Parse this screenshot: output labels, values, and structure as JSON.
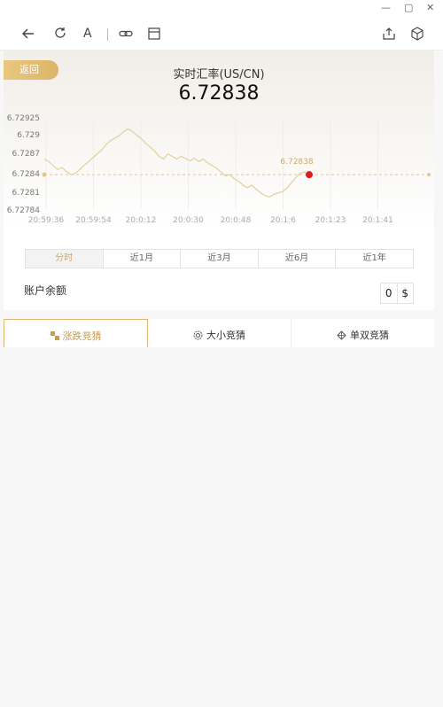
{
  "window": {
    "minimize_glyph": "—",
    "maximize_glyph": "▢",
    "close_glyph": "✕"
  },
  "toolbar": {
    "font_label": "A",
    "icons": [
      "back-arrow-icon",
      "refresh-icon",
      "font-icon",
      "link-icon",
      "window-icon",
      "share-icon",
      "cube-icon"
    ]
  },
  "header": {
    "back_label": "返回",
    "title": "实时汇率(US/CN)",
    "rate": "6.72838"
  },
  "chart_data": {
    "type": "line",
    "title": "",
    "y_ticks": [
      "6.72925",
      "6.729",
      "6.7287",
      "6.7284",
      "6.7281",
      "6.72784"
    ],
    "x_ticks": [
      "20:59:36",
      "20:59:54",
      "20:0:12",
      "20:0:30",
      "20:0:48",
      "20:1:6",
      "20:1:23",
      "20:1:41"
    ],
    "ylim": [
      6.72784,
      6.72925
    ],
    "baseline": 6.72838,
    "current_label": "6.72838",
    "colors": {
      "line": "#e2d19d",
      "baseline": "#e2c88e",
      "current_point": "#e01b1b",
      "grid": "#eeeeee"
    },
    "series": [
      {
        "values": [
          6.72862,
          6.72858,
          6.72852,
          6.72846,
          6.72849,
          6.72843,
          6.72838,
          6.7284,
          6.72846,
          6.72852,
          6.72858,
          6.72864,
          6.7287,
          6.72876,
          6.72884,
          6.7289,
          6.72894,
          6.72898,
          6.72904,
          6.72908,
          6.72904,
          6.72898,
          6.72893,
          6.72886,
          6.7288,
          6.72874,
          6.72866,
          6.72862,
          6.7287,
          6.72866,
          6.72862,
          6.72866,
          6.72863,
          6.72859,
          6.72863,
          6.72858,
          6.72862,
          6.72856,
          6.72852,
          6.72848,
          6.72842,
          6.72836,
          6.72838,
          6.72832,
          6.72828,
          6.72822,
          6.72818,
          6.72822,
          6.72816,
          6.7281,
          6.72806,
          6.72804,
          6.72808,
          6.7281,
          6.72812,
          6.72818,
          6.72826,
          6.72834,
          6.7284,
          6.72842,
          6.72838
        ]
      }
    ]
  },
  "period_tabs": [
    "分时",
    "近1月",
    "近3月",
    "近6月",
    "近1年"
  ],
  "balance": {
    "label": "账户余额",
    "value": "0",
    "currency": "$"
  },
  "game_tabs": [
    {
      "label": "涨跌竞猜",
      "icon": "checker-icon"
    },
    {
      "label": "大小竞猜",
      "icon": "gear-icon"
    },
    {
      "label": "单双竞猜",
      "icon": "diamond-icon"
    }
  ]
}
